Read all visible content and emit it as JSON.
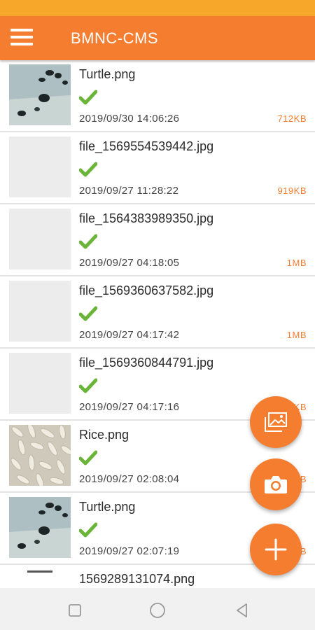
{
  "app": {
    "title": "BMNC-CMS"
  },
  "colors": {
    "accent": "#f47d30",
    "status_bar": "#f7a72a",
    "check": "#6bb43a"
  },
  "files": [
    {
      "name": "Turtle.png",
      "date": "2019/09/30 14:06:26",
      "size": "712KB",
      "thumb": "turtle",
      "uploaded": true
    },
    {
      "name": "file_1569554539442.jpg",
      "date": "2019/09/27 11:28:22",
      "size": "919KB",
      "thumb": "blank",
      "uploaded": true
    },
    {
      "name": "file_1564383989350.jpg",
      "date": "2019/09/27 04:18:05",
      "size": "1MB",
      "thumb": "blank",
      "uploaded": true
    },
    {
      "name": "file_1569360637582.jpg",
      "date": "2019/09/27 04:17:42",
      "size": "1MB",
      "thumb": "blank",
      "uploaded": true
    },
    {
      "name": "file_1569360844791.jpg",
      "date": "2019/09/27 04:17:16",
      "size": "KB",
      "thumb": "blank",
      "uploaded": true
    },
    {
      "name": "Rice.png",
      "date": "2019/09/27 02:08:04",
      "size": "B",
      "thumb": "rice",
      "uploaded": true
    },
    {
      "name": "Turtle.png",
      "date": "2019/09/27 02:07:19",
      "size": "B",
      "thumb": "turtle",
      "uploaded": true
    },
    {
      "name": "1569289131074.png",
      "date": "",
      "size": "",
      "thumb": "partial",
      "uploaded": false
    }
  ],
  "fab": {
    "gallery_icon": "gallery-icon",
    "camera_icon": "camera-icon",
    "add_icon": "plus-icon"
  },
  "navbar": {
    "icons": [
      "recent-apps-icon",
      "home-icon",
      "back-icon"
    ]
  }
}
